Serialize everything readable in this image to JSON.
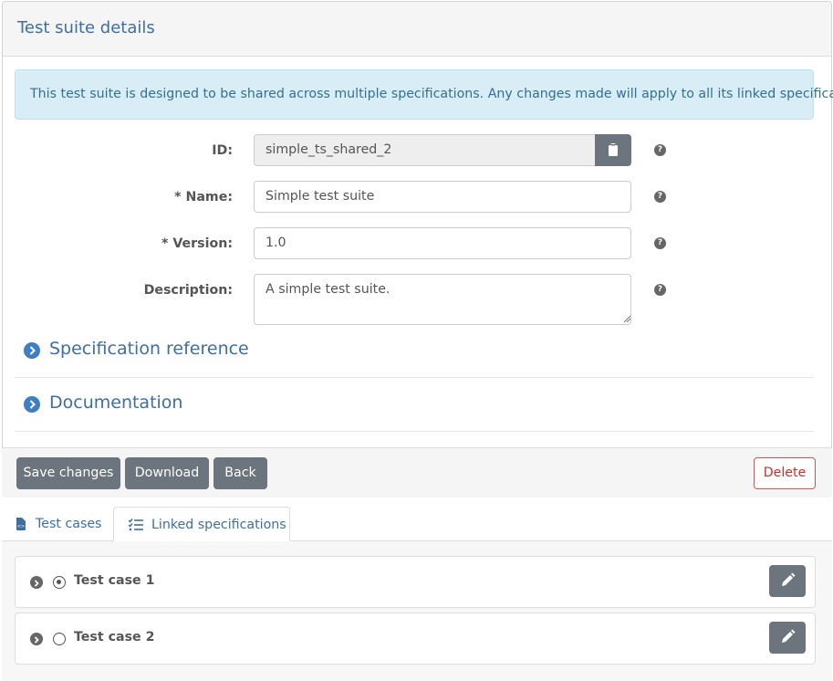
{
  "panel": {
    "title": "Test suite details",
    "alert": "This test suite is designed to be shared across multiple specifications. Any changes made will apply to all its linked specifications."
  },
  "form": {
    "id_label": "ID:",
    "id_value": "simple_ts_shared_2",
    "name_label": "* Name:",
    "name_value": "Simple test suite",
    "version_label": "* Version:",
    "version_value": "1.0",
    "description_label": "Description:",
    "description_value": "A simple test suite.",
    "help_glyph": "?"
  },
  "sections": {
    "spec_reference": "Specification reference",
    "documentation": "Documentation"
  },
  "actions": {
    "save": "Save changes",
    "download": "Download",
    "back": "Back",
    "delete": "Delete"
  },
  "tabs": [
    {
      "label": "Test cases",
      "icon": "file-code-icon",
      "active": true
    },
    {
      "label": "Linked specifications",
      "icon": "list-check-icon",
      "active": false
    }
  ],
  "test_cases": [
    {
      "name": "Test case 1",
      "selected": true
    },
    {
      "name": "Test case 2",
      "selected": false
    }
  ],
  "colors": {
    "accent": "#3d6fa3",
    "button": "#6c757d",
    "danger": "#d9534f",
    "alert_bg": "#d9edf7"
  }
}
